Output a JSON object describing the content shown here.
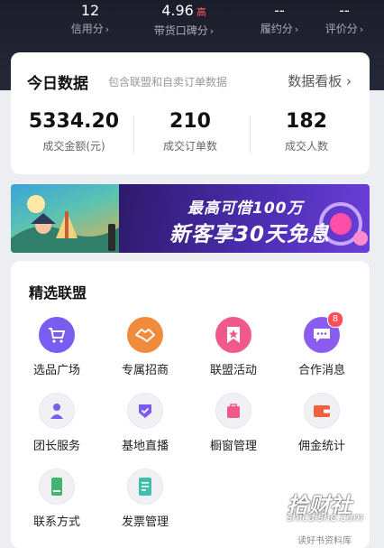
{
  "header_stats": [
    {
      "value": "12",
      "tag": "",
      "label": "信用分"
    },
    {
      "value": "4.96",
      "tag": "高",
      "label": "带货口碑分"
    },
    {
      "value": "--",
      "tag": "",
      "label": "履约分"
    },
    {
      "value": "--",
      "tag": "",
      "label": "评价分"
    }
  ],
  "today": {
    "title": "今日数据",
    "subtitle": "包含联盟和自卖订单数据",
    "link": "数据看板",
    "metrics": [
      {
        "value": "5334.20",
        "label": "成交金额(元)"
      },
      {
        "value": "210",
        "label": "成交订单数"
      },
      {
        "value": "182",
        "label": "成交人数"
      }
    ]
  },
  "banner": {
    "line1": "最高可借100万",
    "line2": "新客享30天免息",
    "slide_count": 3,
    "active_slide": 2
  },
  "alliance": {
    "title": "精选联盟",
    "items": [
      {
        "label": "选品广场",
        "icon": "cart-icon"
      },
      {
        "label": "专属招商",
        "icon": "handshake-icon"
      },
      {
        "label": "联盟活动",
        "icon": "star-flag-icon"
      },
      {
        "label": "合作消息",
        "icon": "message-icon",
        "badge": "8"
      },
      {
        "label": "团长服务",
        "icon": "person-icon"
      },
      {
        "label": "基地直播",
        "icon": "shield-check-icon"
      },
      {
        "label": "橱窗管理",
        "icon": "showcase-bag-icon"
      },
      {
        "label": "佣金统计",
        "icon": "wallet-icon"
      },
      {
        "label": "联系方式",
        "icon": "phone-icon"
      },
      {
        "label": "发票管理",
        "icon": "invoice-icon"
      }
    ]
  },
  "watermark": {
    "brand": "拾财社",
    "domain": "shicaishe.com",
    "caption": "读好书资料库"
  }
}
